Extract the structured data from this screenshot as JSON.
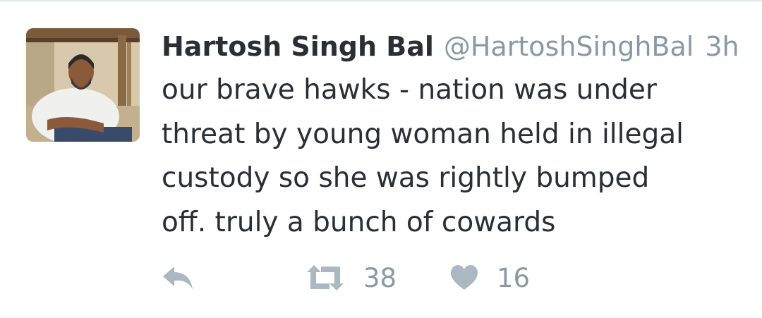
{
  "tweet": {
    "author_name": "Hartosh Singh Bal",
    "author_handle": "@HartoshSinghBal",
    "time_ago": "3h",
    "text": "our brave hawks - nation was under\nthreat by young woman held in illegal\ncustody so she was rightly bumped\noff. truly a bunch of cowards"
  },
  "actions": {
    "reply_icon": "reply-icon",
    "retweet_icon": "retweet-icon",
    "retweet_count": "38",
    "like_icon": "heart-icon",
    "like_count": "16"
  },
  "colors": {
    "text_primary": "#292f33",
    "text_secondary": "#8899a6",
    "icon": "#aab8c2",
    "divider": "#e1e8ed"
  }
}
